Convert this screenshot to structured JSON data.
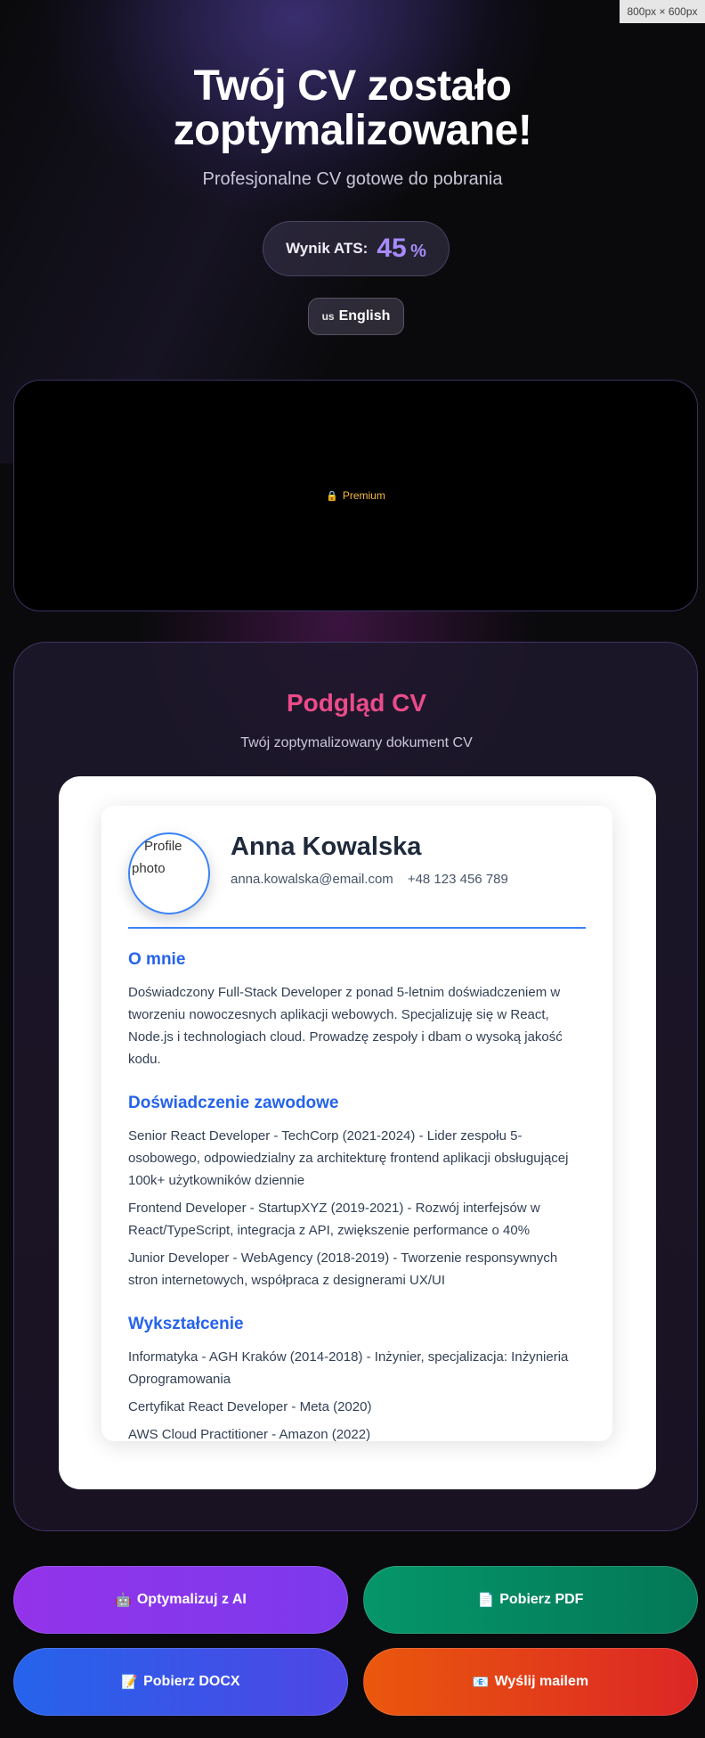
{
  "size_badge": "800px × 600px",
  "hero": {
    "title_line1": "Twój CV zostało",
    "title_line2": "zoptymalizowane!",
    "subtitle": "Profesjonalne CV gotowe do pobrania"
  },
  "ats": {
    "label": "Wynik ATS:",
    "value": "45",
    "unit": "%"
  },
  "language": {
    "flag": "us",
    "label": "English"
  },
  "ad": {
    "premium_label": "Premium",
    "icon": "lock-icon",
    "accent": "#f5b942"
  },
  "preview": {
    "title": "Podgląd CV",
    "subtitle": "Twój zoptymalizowany dokument CV"
  },
  "cv": {
    "photo_alt_line1": "Profile",
    "photo_alt_line2": "photo",
    "name": "Anna Kowalska",
    "email": "anna.kowalska@email.com",
    "phone": "+48 123 456 789",
    "about_heading": "O mnie",
    "about_text": "Doświadczony Full-Stack Developer z ponad 5-letnim doświadczeniem w tworzeniu nowoczesnych aplikacji webowych. Specjalizuję się w React, Node.js i technologiach cloud. Prowadzę zespoły i dbam o wysoką jakość kodu.",
    "experience_heading": "Doświadczenie zawodowe",
    "experience": [
      "Senior React Developer - TechCorp (2021-2024) - Lider zespołu 5-osobowego, odpowiedzialny za architekturę frontend aplikacji obsługującej 100k+ użytkowników dziennie",
      "Frontend Developer - StartupXYZ (2019-2021) - Rozwój interfejsów w React/TypeScript, integracja z API, zwiększenie performance o 40%",
      "Junior Developer - WebAgency (2018-2019) - Tworzenie responsywnych stron internetowych, współpraca z designerami UX/UI"
    ],
    "education_heading": "Wykształcenie",
    "education": [
      "Informatyka - AGH Kraków (2014-2018) - Inżynier, specjalizacja: Inżynieria Oprogramowania",
      "Certyfikat React Developer - Meta (2020)",
      "AWS Cloud Practitioner - Amazon (2022)"
    ],
    "accent": "#2563eb"
  },
  "actions": {
    "optimize": {
      "icon": "robot-icon",
      "glyph": "🤖",
      "label": "Optymalizuj z AI",
      "color": "#9333ea"
    },
    "pdf": {
      "icon": "document-icon",
      "glyph": "📄",
      "label": "Pobierz PDF",
      "color": "#059669"
    },
    "docx": {
      "icon": "memo-icon",
      "glyph": "📝",
      "label": "Pobierz DOCX",
      "color": "#2563eb"
    },
    "email": {
      "icon": "email-icon",
      "glyph": "📧",
      "label": "Wyślij mailem",
      "color": "#ea580c"
    }
  }
}
